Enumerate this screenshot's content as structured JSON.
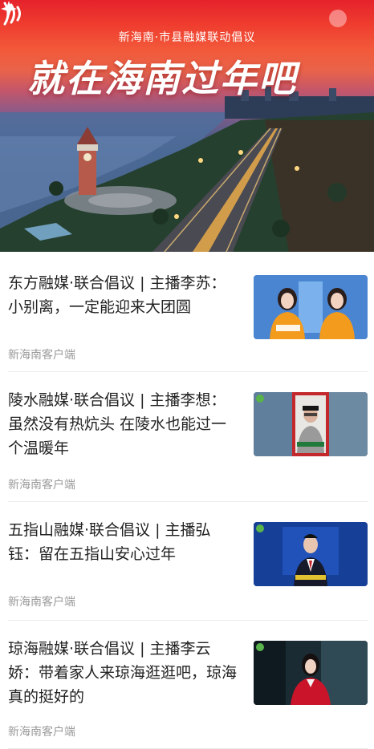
{
  "banner": {
    "subtitle": "新海南·市县融媒联动倡议",
    "title": "就在海南过年吧",
    "icons": [
      "star-icon",
      "waves-icon"
    ]
  },
  "news": [
    {
      "title": "东方融媒·联合倡议 | 主播李苏：小别离，一定能迎来大团圆",
      "source": "新海南客户端",
      "thumb": "two-anchors-orange-jackets"
    },
    {
      "title": "陵水融媒·联合倡议 | 主播李想：虽然没有热炕头 在陵水也能过一个温暖年",
      "source": "新海南客户端",
      "thumb": "man-in-red-frame"
    },
    {
      "title": "五指山融媒·联合倡议 | 主播弘钰：留在五指山安心过年",
      "source": "新海南客户端",
      "thumb": "male-anchor-blue-studio"
    },
    {
      "title": "琼海融媒·联合倡议 | 主播李云娇：带着家人来琼海逛逛吧，琼海真的挺好的",
      "source": "新海南客户端",
      "thumb": "female-anchor-red-jacket"
    }
  ],
  "colors": {
    "banner_red": "#e5222b",
    "title_text": "#222222",
    "source_text": "#9a9a9a",
    "divider": "#ececec"
  }
}
